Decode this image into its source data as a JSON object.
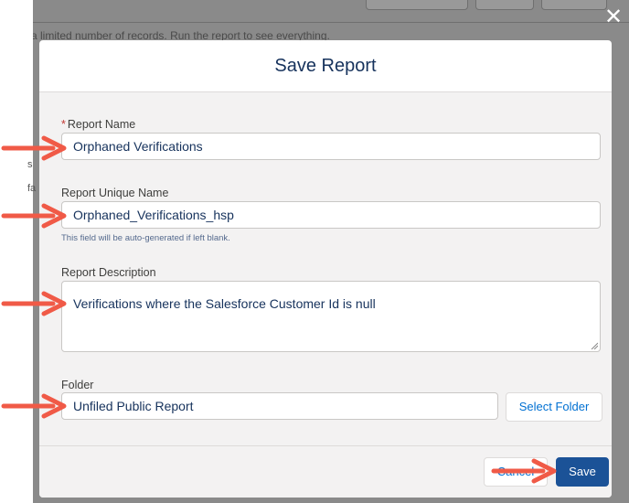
{
  "background": {
    "notice": "a limited number of records. Run the report to see everything."
  },
  "modal": {
    "title": "Save Report",
    "close_icon": "close-icon"
  },
  "fields": {
    "report_name": {
      "label": "Report Name",
      "required_marker": "*",
      "value": "Orphaned Verifications"
    },
    "unique_name": {
      "label": "Report Unique Name",
      "value": "Orphaned_Verifications_hsp",
      "hint": "This field will be auto-generated if left blank."
    },
    "description": {
      "label": "Report Description",
      "value": "Verifications where the Salesforce Customer Id is null"
    },
    "folder": {
      "label": "Folder",
      "value": "Unfiled Public Report",
      "select_button": "Select Folder"
    }
  },
  "footer": {
    "cancel_label": "Cancel",
    "save_label": "Save"
  },
  "colors": {
    "annotation_arrow": "#f05a47",
    "brand_button": "#1b5297",
    "link_text": "#0070d2"
  }
}
